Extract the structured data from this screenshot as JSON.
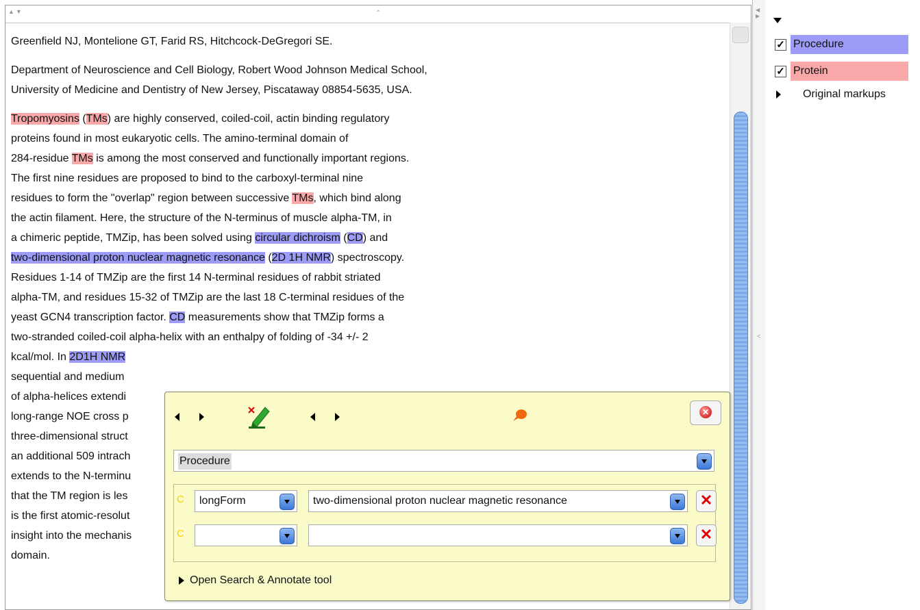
{
  "document": {
    "authors": "Greenfield NJ, Montelione GT, Farid RS, Hitchcock-DeGregori SE.",
    "affiliation_lines": [
      "Department of Neuroscience and Cell Biology, Robert Wood Johnson Medical School,",
      "University of Medicine and Dentistry of New Jersey, Piscataway 08854-5635, USA."
    ],
    "abstract_lines": [
      [
        {
          "t": "Tropomyosins",
          "h": "prot"
        },
        {
          "t": " ("
        },
        {
          "t": "TMs",
          "h": "prot"
        },
        {
          "t": ") are highly conserved, coiled-coil, actin binding regulatory"
        }
      ],
      [
        {
          "t": "proteins found in most eukaryotic cells. The amino-terminal domain of"
        }
      ],
      [
        {
          "t": "284-residue "
        },
        {
          "t": "TMs",
          "h": "prot"
        },
        {
          "t": " is among the most conserved and functionally important regions."
        }
      ],
      [
        {
          "t": "The first nine residues are proposed to bind to the carboxyl-terminal nine"
        }
      ],
      [
        {
          "t": "residues to form the \"overlap\" region between successive "
        },
        {
          "t": "TMs",
          "h": "prot"
        },
        {
          "t": ", which bind along"
        }
      ],
      [
        {
          "t": "the actin filament. Here, the structure of the N-terminus of muscle alpha-TM, in"
        }
      ],
      [
        {
          "t": "a chimeric peptide, TMZip, has been solved using "
        },
        {
          "t": "circular dichroism",
          "h": "proc"
        },
        {
          "t": " ("
        },
        {
          "t": "CD",
          "h": "proc"
        },
        {
          "t": ") and"
        }
      ],
      [
        {
          "t": "two-dimensional proton nuclear magnetic resonance",
          "h": "proc"
        },
        {
          "t": " ("
        },
        {
          "t": "2D 1H NMR",
          "h": "proc"
        },
        {
          "t": ") spectroscopy."
        }
      ],
      [
        {
          "t": "Residues 1-14 of TMZip are the first 14 N-terminal residues of rabbit striated"
        }
      ],
      [
        {
          "t": "alpha-TM, and residues 15-32 of TMZip are the last 18 C-terminal residues of the"
        }
      ],
      [
        {
          "t": "yeast GCN4 transcription factor. "
        },
        {
          "t": "CD",
          "h": "proc"
        },
        {
          "t": " measurements show that TMZip forms a"
        }
      ],
      [
        {
          "t": "two-stranded coiled-coil alpha-helix with an enthalpy of folding of -34 +/- 2"
        }
      ],
      [
        {
          "t": "kcal/mol. In "
        },
        {
          "t": "2D1H NMR",
          "h": "proc"
        }
      ],
      [
        {
          "t": "sequential and medium"
        }
      ],
      [
        {
          "t": "of alpha-helices extendi"
        }
      ],
      [
        {
          "t": "long-range NOE cross p"
        }
      ],
      [
        {
          "t": "three-dimensional struct"
        }
      ],
      [
        {
          "t": "an additional 509 intrach"
        }
      ],
      [
        {
          "t": "extends to the N-terminu"
        }
      ],
      [
        {
          "t": "that the TM region is les"
        }
      ],
      [
        {
          "t": "is the first atomic-resolut"
        }
      ],
      [
        {
          "t": "insight into the mechanis"
        }
      ],
      [
        {
          "t": "domain."
        }
      ]
    ]
  },
  "sidebar": {
    "items": [
      {
        "label": "Procedure",
        "checked": true,
        "color": "#9c9cf7"
      },
      {
        "label": "Protein",
        "checked": true,
        "color": "#f8a8a8"
      },
      {
        "label": "Original markups"
      }
    ]
  },
  "popup": {
    "annotation_type": "Procedure",
    "features": [
      {
        "name": "longForm",
        "value": "two-dimensional proton nuclear magnetic resonance"
      },
      {
        "name": "",
        "value": ""
      }
    ],
    "open_tool_label": "Open Search & Annotate tool"
  },
  "colors": {
    "procedure": "#9c9cf7",
    "protein": "#f8a8a8",
    "popup_bg": "#fbfbc9"
  },
  "icons": [
    "pencil-delete-icon",
    "pin-icon",
    "close-icon",
    "delete-feature-icon"
  ]
}
